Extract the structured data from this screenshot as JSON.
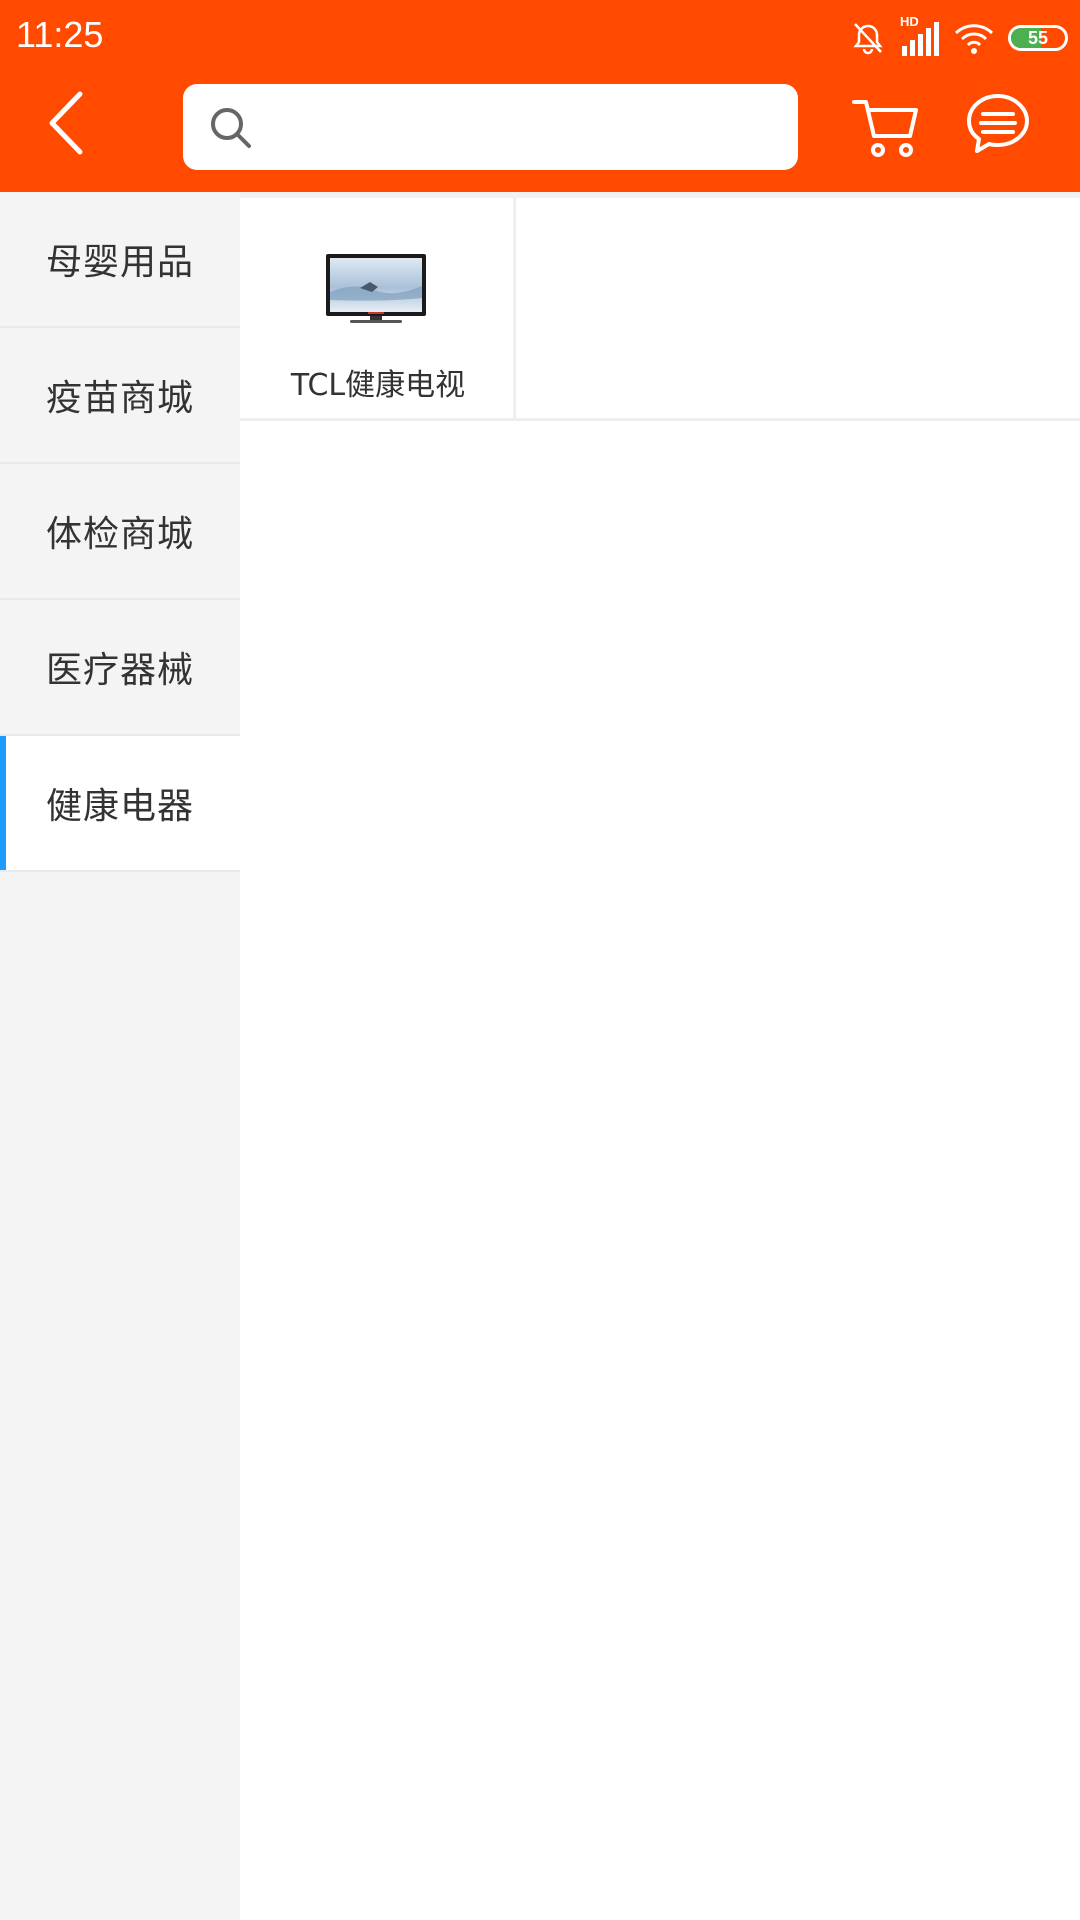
{
  "status_bar": {
    "time": "11:25",
    "network_label": "HD",
    "battery_level": "55",
    "battery_fraction": 0.55,
    "icons": [
      "mute-alarm-icon",
      "signal-icon",
      "wifi-icon",
      "battery-icon"
    ]
  },
  "header": {
    "back_icon": "chevron-left-icon",
    "search": {
      "placeholder": "",
      "value": "",
      "icon": "search-icon"
    },
    "cart_icon": "cart-icon",
    "message_icon": "message-icon"
  },
  "sidebar": {
    "items": [
      {
        "label": "母婴用品",
        "active": false
      },
      {
        "label": "疫苗商城",
        "active": false
      },
      {
        "label": "体检商城",
        "active": false
      },
      {
        "label": "医疗器械",
        "active": false
      },
      {
        "label": "健康电器",
        "active": true
      }
    ]
  },
  "products": [
    {
      "name": "TCL健康电视",
      "image_icon": "tv-icon"
    }
  ],
  "colors": {
    "header_bg": "#ff4a00",
    "sidebar_bg": "#f4f4f4",
    "active_indicator": "#1e9bff",
    "battery_fill": "#4caf50"
  }
}
